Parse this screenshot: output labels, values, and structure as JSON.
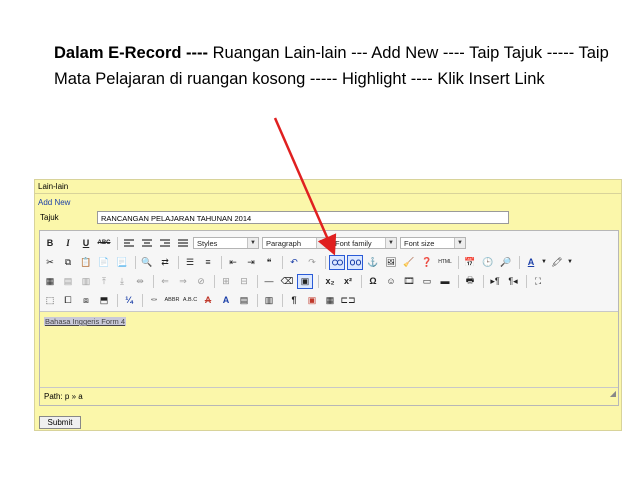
{
  "caption": {
    "bold": "Dalam E-Record ----",
    "rest": " Ruangan Lain-lain --- Add New  ----  Taip Tajuk -----  Taip Mata Pelajaran di ruangan kosong ----- Highlight ---- Klik Insert Link"
  },
  "panel": {
    "header": "Lain-lain",
    "add_new": "Add New",
    "tajuk_label": "Tajuk",
    "tajuk_value": "RANCANGAN PELAJARAN TAHUNAN 2014"
  },
  "toolbar": {
    "bold": "B",
    "italic": "I",
    "underline": "U",
    "strike": "ABC",
    "styles": "Styles",
    "paragraph": "Paragraph",
    "font_family": "Font family",
    "font_size": "Font size"
  },
  "editor": {
    "content": "Bahasa Inggeris Form 4",
    "path": "Path: p » a"
  },
  "submit_label": "Submit",
  "colors": {
    "panel_bg": "#fbf7aa",
    "arrow": "#e02020",
    "link": "#1b3fa8",
    "highlight_border": "#2a5bd7"
  }
}
